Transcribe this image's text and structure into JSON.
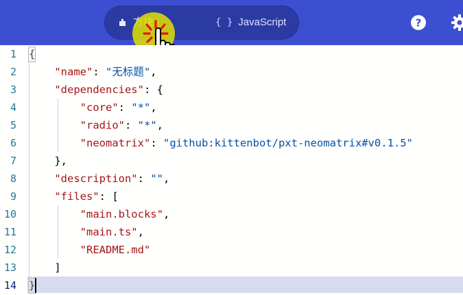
{
  "topbar": {
    "tabs": [
      {
        "label": "方块",
        "icon": "puzzle-icon",
        "active": true
      },
      {
        "label": "JavaScript",
        "icon": "braces-icon",
        "active": false
      }
    ],
    "js_icon_text": "{ }",
    "help_icon": "help-icon",
    "settings_icon": "gear-icon"
  },
  "editor": {
    "line_numbers": [
      "1",
      "2",
      "3",
      "4",
      "5",
      "6",
      "7",
      "8",
      "9",
      "10",
      "11",
      "12",
      "13",
      "14"
    ],
    "highlighted_line": 14,
    "lines": [
      [
        {
          "t": "{",
          "c": "p"
        }
      ],
      [
        {
          "t": "    ",
          "c": "p"
        },
        {
          "t": "\"name\"",
          "c": "k"
        },
        {
          "t": ": ",
          "c": "p"
        },
        {
          "t": "\"无标题\"",
          "c": "s"
        },
        {
          "t": ",",
          "c": "p"
        }
      ],
      [
        {
          "t": "    ",
          "c": "p"
        },
        {
          "t": "\"dependencies\"",
          "c": "k"
        },
        {
          "t": ": {",
          "c": "p"
        }
      ],
      [
        {
          "t": "        ",
          "c": "p"
        },
        {
          "t": "\"core\"",
          "c": "k"
        },
        {
          "t": ": ",
          "c": "p"
        },
        {
          "t": "\"*\"",
          "c": "s"
        },
        {
          "t": ",",
          "c": "p"
        }
      ],
      [
        {
          "t": "        ",
          "c": "p"
        },
        {
          "t": "\"radio\"",
          "c": "k"
        },
        {
          "t": ": ",
          "c": "p"
        },
        {
          "t": "\"*\"",
          "c": "s"
        },
        {
          "t": ",",
          "c": "p"
        }
      ],
      [
        {
          "t": "        ",
          "c": "p"
        },
        {
          "t": "\"neomatrix\"",
          "c": "k"
        },
        {
          "t": ": ",
          "c": "p"
        },
        {
          "t": "\"github:kittenbot/pxt-neomatrix#v0.1.5\"",
          "c": "s"
        }
      ],
      [
        {
          "t": "    },",
          "c": "p"
        }
      ],
      [
        {
          "t": "    ",
          "c": "p"
        },
        {
          "t": "\"description\"",
          "c": "k"
        },
        {
          "t": ": ",
          "c": "p"
        },
        {
          "t": "\"\"",
          "c": "s"
        },
        {
          "t": ",",
          "c": "p"
        }
      ],
      [
        {
          "t": "    ",
          "c": "p"
        },
        {
          "t": "\"files\"",
          "c": "k"
        },
        {
          "t": ": [",
          "c": "p"
        }
      ],
      [
        {
          "t": "        ",
          "c": "p"
        },
        {
          "t": "\"main.blocks\"",
          "c": "k"
        },
        {
          "t": ",",
          "c": "p"
        }
      ],
      [
        {
          "t": "        ",
          "c": "p"
        },
        {
          "t": "\"main.ts\"",
          "c": "k"
        },
        {
          "t": ",",
          "c": "p"
        }
      ],
      [
        {
          "t": "        ",
          "c": "p"
        },
        {
          "t": "\"README.md\"",
          "c": "k"
        }
      ],
      [
        {
          "t": "    ]",
          "c": "p"
        }
      ],
      [
        {
          "t": "}",
          "c": "p"
        }
      ]
    ]
  },
  "colors": {
    "topbar": "#3c4fd1",
    "toggle": "#2c3ba3",
    "key": "#a31515",
    "string": "#0451a5",
    "line_number": "#237893",
    "current_line": "#d7dbf0"
  }
}
